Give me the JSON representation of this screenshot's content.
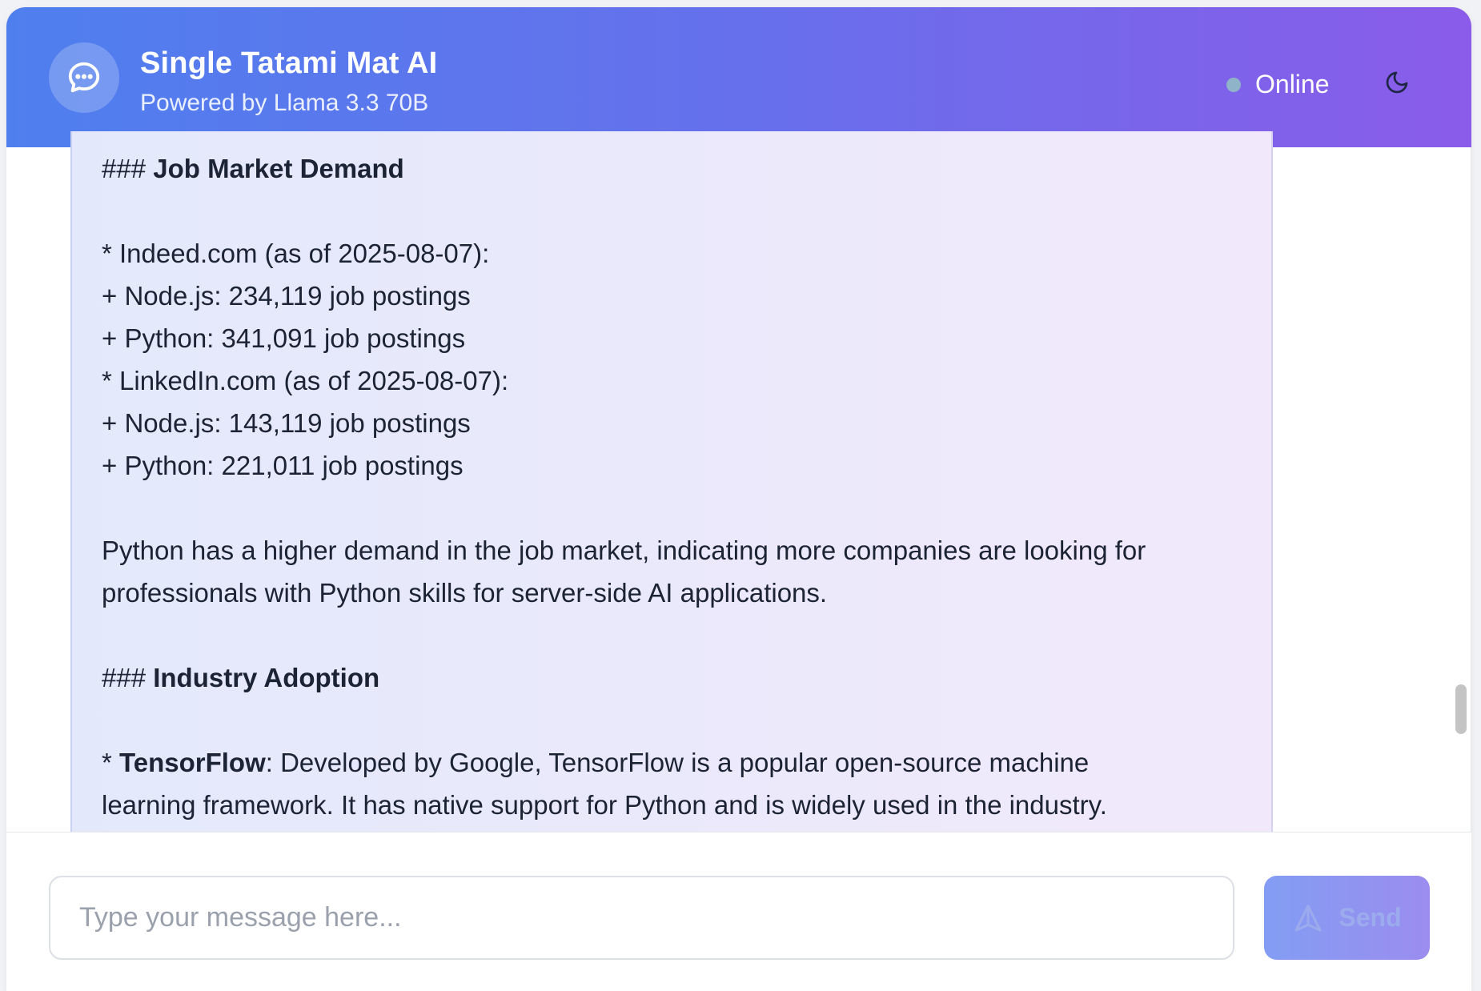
{
  "header": {
    "title": "Single Tatami Mat AI",
    "subtitle": "Powered by Llama 3.3 70B",
    "status": "Online",
    "logo_icon": "chat-bubble-icon",
    "theme_icon": "moon-icon"
  },
  "message": {
    "heading1_prefix": "###",
    "heading1": "Job Market Demand",
    "lines": [
      "* Indeed.com (as of 2025-08-07):",
      "+ Node.js: 234,119 job postings",
      "+ Python: 341,091 job postings",
      "* LinkedIn.com (as of 2025-08-07):",
      "+ Node.js: 143,119 job postings",
      "+ Python: 221,011 job postings"
    ],
    "paragraph_line1": "Python has a higher demand in the job market, indicating more companies are looking for",
    "paragraph_line2": "professionals with Python skills for server-side AI applications.",
    "heading2_prefix": "###",
    "heading2": "Industry Adoption",
    "bullet_prefix": "*",
    "bullet_bold": "TensorFlow",
    "bullet_text_line1": ": Developed by Google, TensorFlow is a popular open-source machine",
    "bullet_text_line2": "learning framework. It has native support for Python and is widely used in the industry."
  },
  "composer": {
    "placeholder": "Type your message here...",
    "value": "",
    "send_label": "Send",
    "send_icon": "send-arrow-icon"
  },
  "colors": {
    "header_gradient_start": "#4f7fee",
    "header_gradient_end": "#8a5ce9",
    "status_dot": "#8fb3c9",
    "text": "#1c2333"
  }
}
